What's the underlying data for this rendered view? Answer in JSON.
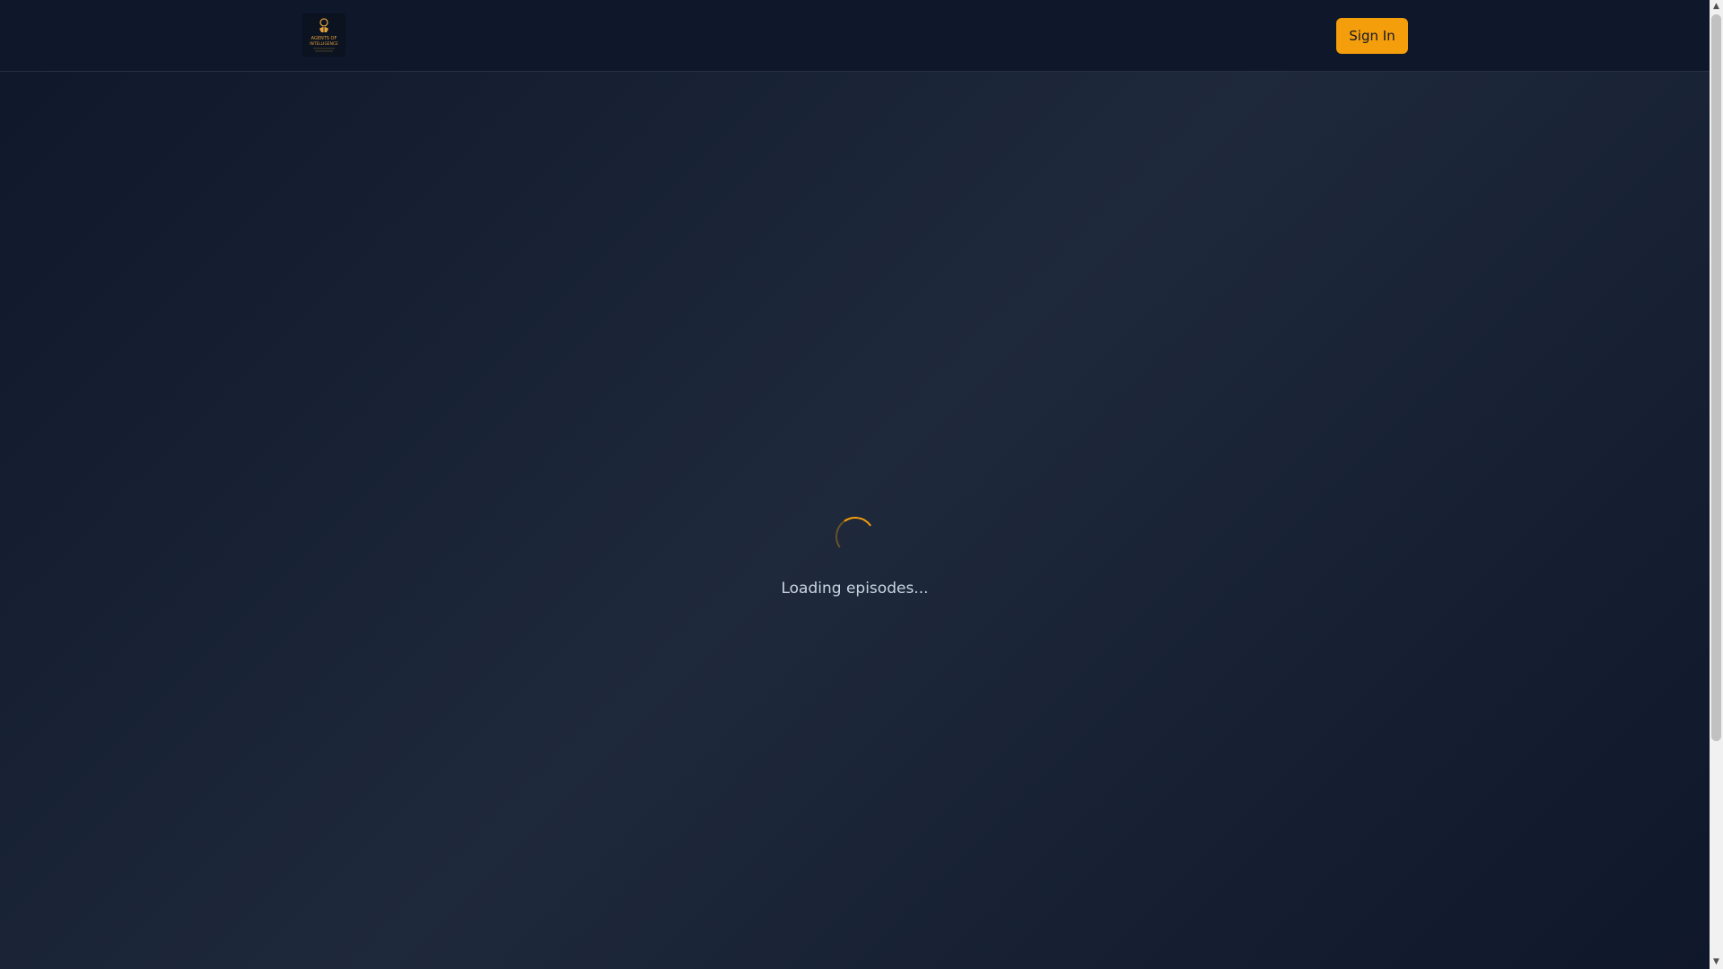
{
  "header": {
    "logo": {
      "icon": "podcast-logo-icon",
      "text_line1": "AGENTS OF",
      "text_line2": "INTELLIGENCE"
    },
    "signin_label": "Sign In"
  },
  "main": {
    "loading_text": "Loading episodes..."
  },
  "scrollbar": {
    "up_glyph": "▲",
    "down_glyph": "▼"
  },
  "colors": {
    "accent": "#f59e0b",
    "background": "#0f172a",
    "surface": "#1e293b",
    "text_muted": "#cbd5e1"
  }
}
